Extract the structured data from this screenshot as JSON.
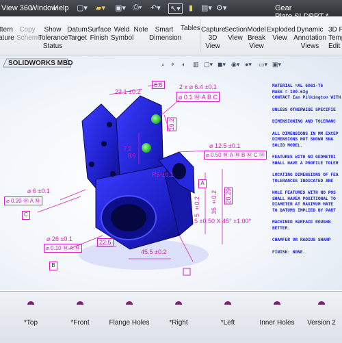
{
  "menubar": {
    "items": [
      "View 360",
      "Window",
      "Help"
    ],
    "document_title": "Gear Plate.SLDPRT *"
  },
  "ribbon": {
    "buttons": [
      {
        "label": "ttern\nature",
        "enabled": true
      },
      {
        "label": "Copy\nScheme",
        "enabled": false
      },
      {
        "label": "Show\nTolerance\nStatus",
        "enabled": true
      },
      {
        "label": "Datum\nTarget",
        "enabled": true
      },
      {
        "label": "Surface\nFinish",
        "enabled": true
      },
      {
        "label": "Weld\nSymbol",
        "enabled": true
      },
      {
        "label": "Note",
        "enabled": true
      },
      {
        "label": "Smart\nDimension",
        "enabled": true
      },
      {
        "label": "Capture\n3D\nView",
        "enabled": true
      },
      {
        "label": "Section\nView",
        "enabled": true
      },
      {
        "label": "Model\nBreak\nView",
        "enabled": true
      },
      {
        "label": "Exploded\nView",
        "enabled": true
      },
      {
        "label": "Dynamic\nAnnotation\nViews",
        "enabled": true
      },
      {
        "label": "3D F\nTemp\nEdit",
        "enabled": true
      }
    ],
    "tables_label": "Tables"
  },
  "viewport": {
    "tab_label": "SOLIDWORKS MBD",
    "dimensions": {
      "d1": "22.1 ±0.2",
      "d2": "6.6",
      "d3": "2 x ⌀ 6.4 ±0.1",
      "d4": "⌀ 0.1 Ⓜ A B C",
      "d5": "19.2",
      "d6": "⌀ 12.5 ±0.1",
      "d7": "⌀ 0.50 Ⓜ A Ⓜ B Ⓜ C Ⓜ",
      "d8": "⌀ 6 ±0.1",
      "d9": "⌀ 0.20 Ⓜ A Ⓜ",
      "d10": "⌀ 26 ±0.1",
      "d11": "⌀ 0.10 Ⓜ A Ⓜ",
      "d12": "R5 ±0.1",
      "d13": "5 ±0.2",
      "d14": "35 ±0.2",
      "d15": "20.29",
      "d16": "22.5",
      "d17": "45.5 ±0.2",
      "d18": "5 ±0.50  X 45° ±1.00°",
      "d19": "7.2",
      "d20": "8.6"
    },
    "datums": [
      "A",
      "B",
      "C"
    ],
    "notes": [
      "MATERIAL =AL 6061-T6",
      "MASS = 100.63g",
      "CONTACT  Ian Pilkington WITH A",
      "",
      "UNLESS OTHERWISE SPECIFIE",
      "",
      "DIMENSIONING AND TOLERANC",
      "",
      "ALL DIMENSIONS IN MM EXCEP",
      "DIMENSIONS NOT SHOWN SHA",
      "SOLID MODEL.",
      "",
      "FEATURES WITH NO GEOMETRI",
      "SHALL HAVE A PROFILE TOLER",
      "",
      "LOCATING DIMENSIONS OF FEA",
      "TOLERANCES INDICATED ARE",
      "",
      "HOLE FEATURES WITH NO POS",
      "SHALL HAVEA POSITIONAL TO",
      "DIAMETER AT MAXIMUM MATE",
      "TO DATUMS IMPLIED BY PART",
      "",
      "MACHINED SURFACE ROUGHN",
      "BETTER.",
      "",
      "CHAMFER OR RADIUS SHARP",
      "",
      "FINISH:  NONE."
    ],
    "colors": {
      "part": "#1d1fc8",
      "annotation": "#d21fbd",
      "notes": "#1218d6",
      "hole_highlight": "#2fd33a"
    }
  },
  "views": [
    {
      "label": "*Top",
      "icon": "top-view-icon"
    },
    {
      "label": "*Front",
      "icon": "front-view-icon"
    },
    {
      "label": "Flange Holes",
      "icon": "flange-holes-view-icon"
    },
    {
      "label": "*Right",
      "icon": "right-view-icon"
    },
    {
      "label": "*Left",
      "icon": "left-view-icon"
    },
    {
      "label": "Inner Holes",
      "icon": "inner-holes-view-icon"
    },
    {
      "label": "Version 2",
      "icon": "version-2-view-icon"
    }
  ]
}
